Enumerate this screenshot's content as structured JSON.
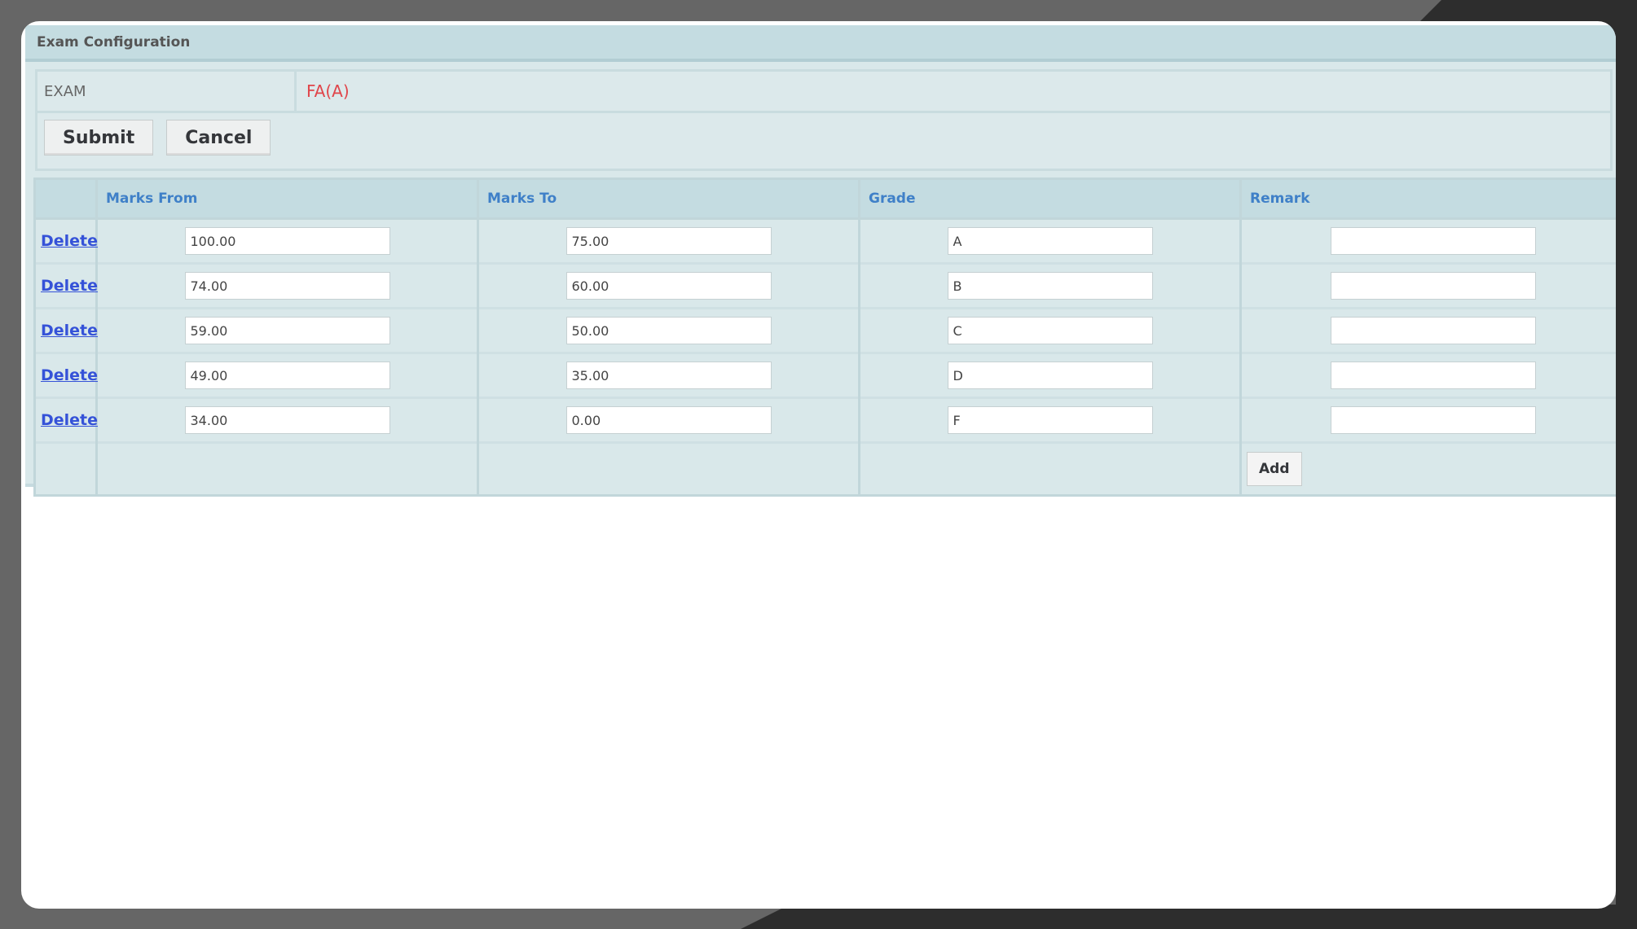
{
  "panel": {
    "title": "Exam Configuration"
  },
  "exam": {
    "label": "EXAM",
    "value": "FA(A)"
  },
  "buttons": {
    "submit": "Submit",
    "cancel": "Cancel",
    "add": "Add"
  },
  "table": {
    "columns": [
      "",
      "Marks From",
      "Marks To",
      "Grade",
      "Remark"
    ],
    "delete_label": "Delete",
    "rows": [
      {
        "marks_from": "100.00",
        "marks_to": "75.00",
        "grade": "A",
        "remark": ""
      },
      {
        "marks_from": "74.00",
        "marks_to": "60.00",
        "grade": "B",
        "remark": ""
      },
      {
        "marks_from": "59.00",
        "marks_to": "50.00",
        "grade": "C",
        "remark": ""
      },
      {
        "marks_from": "49.00",
        "marks_to": "35.00",
        "grade": "D",
        "remark": ""
      },
      {
        "marks_from": "34.00",
        "marks_to": "0.00",
        "grade": "F",
        "remark": ""
      }
    ]
  }
}
